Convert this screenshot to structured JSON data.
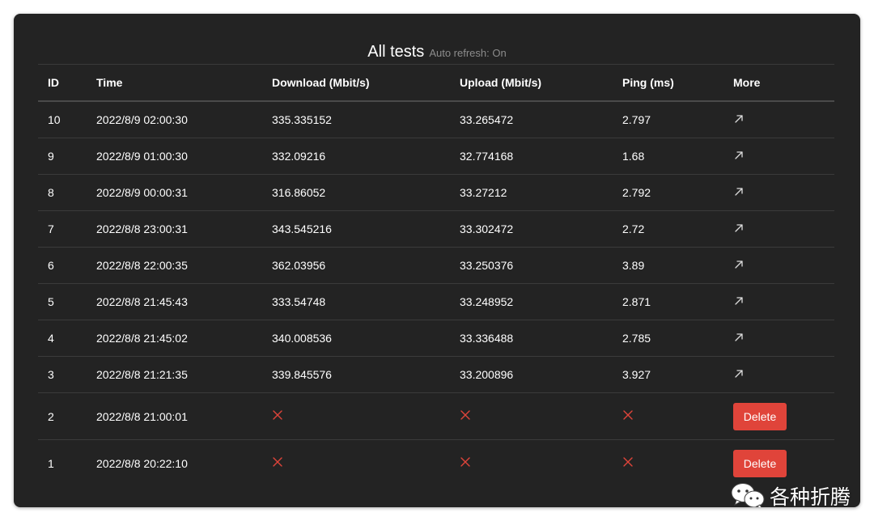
{
  "header": {
    "title": "All tests",
    "subtitle": "Auto refresh: On"
  },
  "columns": {
    "id": "ID",
    "time": "Time",
    "download": "Download (Mbit/s)",
    "upload": "Upload (Mbit/s)",
    "ping": "Ping (ms)",
    "more": "More"
  },
  "rows": [
    {
      "id": "10",
      "time": "2022/8/9 02:00:30",
      "download": "335.335152",
      "upload": "33.265472",
      "ping": "2.797",
      "status": "ok",
      "more_icon": "arrow-up-right-icon"
    },
    {
      "id": "9",
      "time": "2022/8/9 01:00:30",
      "download": "332.09216",
      "upload": "32.774168",
      "ping": "1.68",
      "status": "ok",
      "more_icon": "arrow-up-right-icon"
    },
    {
      "id": "8",
      "time": "2022/8/9 00:00:31",
      "download": "316.86052",
      "upload": "33.27212",
      "ping": "2.792",
      "status": "ok",
      "more_icon": "arrow-up-right-icon"
    },
    {
      "id": "7",
      "time": "2022/8/8 23:00:31",
      "download": "343.545216",
      "upload": "33.302472",
      "ping": "2.72",
      "status": "ok",
      "more_icon": "arrow-up-right-icon"
    },
    {
      "id": "6",
      "time": "2022/8/8 22:00:35",
      "download": "362.03956",
      "upload": "33.250376",
      "ping": "3.89",
      "status": "ok",
      "more_icon": "arrow-up-right-icon"
    },
    {
      "id": "5",
      "time": "2022/8/8 21:45:43",
      "download": "333.54748",
      "upload": "33.248952",
      "ping": "2.871",
      "status": "ok",
      "more_icon": "arrow-up-right-icon"
    },
    {
      "id": "4",
      "time": "2022/8/8 21:45:02",
      "download": "340.008536",
      "upload": "33.336488",
      "ping": "2.785",
      "status": "ok",
      "more_icon": "arrow-up-right-icon"
    },
    {
      "id": "3",
      "time": "2022/8/8 21:21:35",
      "download": "339.845576",
      "upload": "33.200896",
      "ping": "3.927",
      "status": "ok",
      "more_icon": "arrow-up-right-icon"
    },
    {
      "id": "2",
      "time": "2022/8/8 21:00:01",
      "status": "failed",
      "fail_icon": "x-mark-icon",
      "delete_label": "Delete"
    },
    {
      "id": "1",
      "time": "2022/8/8 20:22:10",
      "status": "failed",
      "fail_icon": "x-mark-icon",
      "delete_label": "Delete"
    }
  ],
  "colors": {
    "panel_bg": "#232323",
    "delete_button": "#e0443a",
    "fail_mark": "#e0443a",
    "subtitle": "#8c8c8c"
  },
  "watermark": {
    "icon": "wechat-icon",
    "text": "各种折腾"
  }
}
